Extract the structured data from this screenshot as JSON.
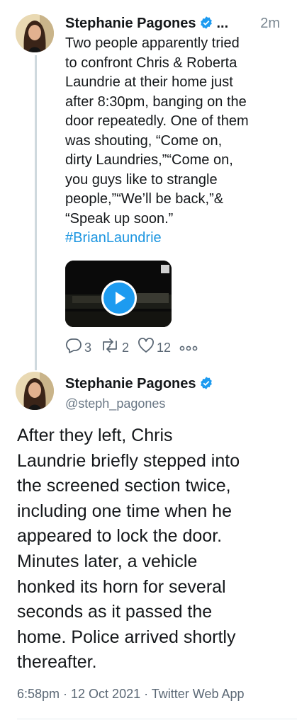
{
  "tweet1": {
    "author_name": "Stephanie Pagones",
    "truncation": "...",
    "time": "2m",
    "text_lines": [
      "Two people apparently tried",
      "to confront Chris & Roberta",
      "Laundrie at their home just",
      "after 8:30pm, banging on the",
      "door repeatedly. One of them",
      "was shouting, “Come on,",
      "dirty Laundries,”“Come on,",
      "you guys like to strangle",
      "people,”“We’ll be back,”&",
      "“Speak up soon.”"
    ],
    "hashtag": "#BrianLaundrie",
    "media_type": "video",
    "actions": {
      "replies": "3",
      "retweets": "2",
      "likes": "12"
    }
  },
  "tweet2": {
    "author_name": "Stephanie Pagones",
    "handle": "@steph_pagones",
    "text_lines": [
      "After they left, Chris",
      "Laundrie briefly stepped into",
      "the screened section twice,",
      "including one time when he",
      "appeared to lock the door.",
      "Minutes later, a vehicle",
      "honked its horn for several",
      "seconds as it passed the",
      "home. Police arrived shortly",
      "thereafter."
    ],
    "footer": "6:58pm · 12 Oct 2021 · Twitter Web App"
  },
  "colors": {
    "link": "#1b95e0",
    "verified": "#1d9bf0",
    "muted": "#5b6875"
  },
  "icons": [
    "verified-badge-icon",
    "play-icon",
    "reply-icon",
    "retweet-icon",
    "like-icon",
    "more-icon"
  ]
}
